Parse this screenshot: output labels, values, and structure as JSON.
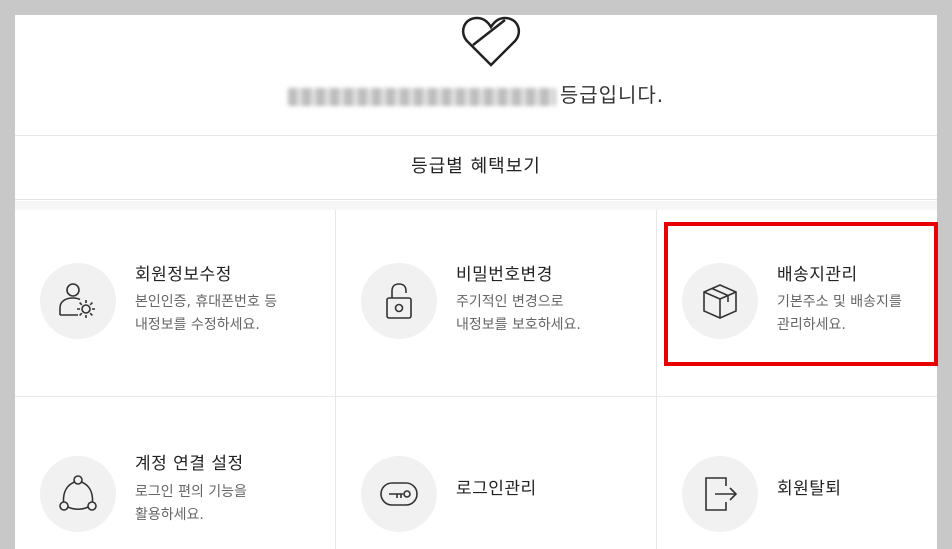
{
  "header": {
    "icon": "heart-icon",
    "grade_suffix": "등급입니다."
  },
  "benefits_link": "등급별 혜택보기",
  "menu": [
    {
      "title": "회원정보수정",
      "desc": "본인인증, 휴대폰번호 등\n내정보를 수정하세요.",
      "icon": "user-settings-icon"
    },
    {
      "title": "비밀번호변경",
      "desc": "주기적인 변경으로\n내정보를 보호하세요.",
      "icon": "unlock-icon"
    },
    {
      "title": "배송지관리",
      "desc": "기본주소 및 배송지를\n관리하세요.",
      "icon": "box-icon"
    },
    {
      "title": "계정 연결 설정",
      "desc": "로그인 편의 기능을\n활용하세요.",
      "icon": "share-icon"
    },
    {
      "title": "로그인관리",
      "desc": "",
      "icon": "key-icon"
    },
    {
      "title": "회원탈퇴",
      "desc": "",
      "icon": "exit-icon"
    }
  ],
  "colors": {
    "highlight": "#e60000",
    "icon_bg": "#f1f1f1",
    "page_bg": "#c8c8c8"
  }
}
